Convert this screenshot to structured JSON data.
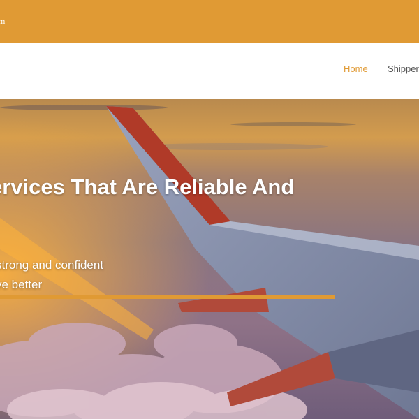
{
  "topbar": {
    "text": "m"
  },
  "nav": {
    "home": "Home",
    "shipper": "Shipper"
  },
  "hero": {
    "title": "ervices That Are Reliable And",
    "line1": "strong and confident",
    "line2": "ve better"
  },
  "colors": {
    "accent": "#e09a34"
  }
}
